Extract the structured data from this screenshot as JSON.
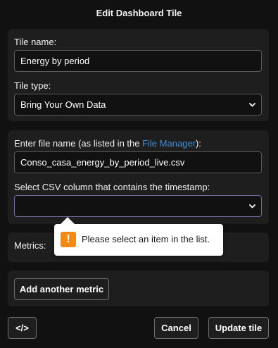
{
  "dialog": {
    "title": "Edit Dashboard Tile"
  },
  "tile": {
    "name_label": "Tile name:",
    "name_value": "Energy by period",
    "type_label": "Tile type:",
    "type_value": "Bring Your Own Data"
  },
  "file": {
    "label_prefix": "Enter file name (as listed in the ",
    "label_link": "File Manager",
    "label_suffix": "):",
    "value": "Conso_casa_energy_by_period_live.csv",
    "timestamp_label": "Select CSV column that contains the timestamp:",
    "timestamp_value": ""
  },
  "validation": {
    "message": "Please select an item in the list.",
    "icon": "warning-icon",
    "icon_glyph": "!",
    "color": "#f38a13"
  },
  "metrics": {
    "label": "Metrics:",
    "add_button": "Add another metric"
  },
  "footer": {
    "code_button": "</>",
    "cancel_button": "Cancel",
    "update_button": "Update tile"
  }
}
